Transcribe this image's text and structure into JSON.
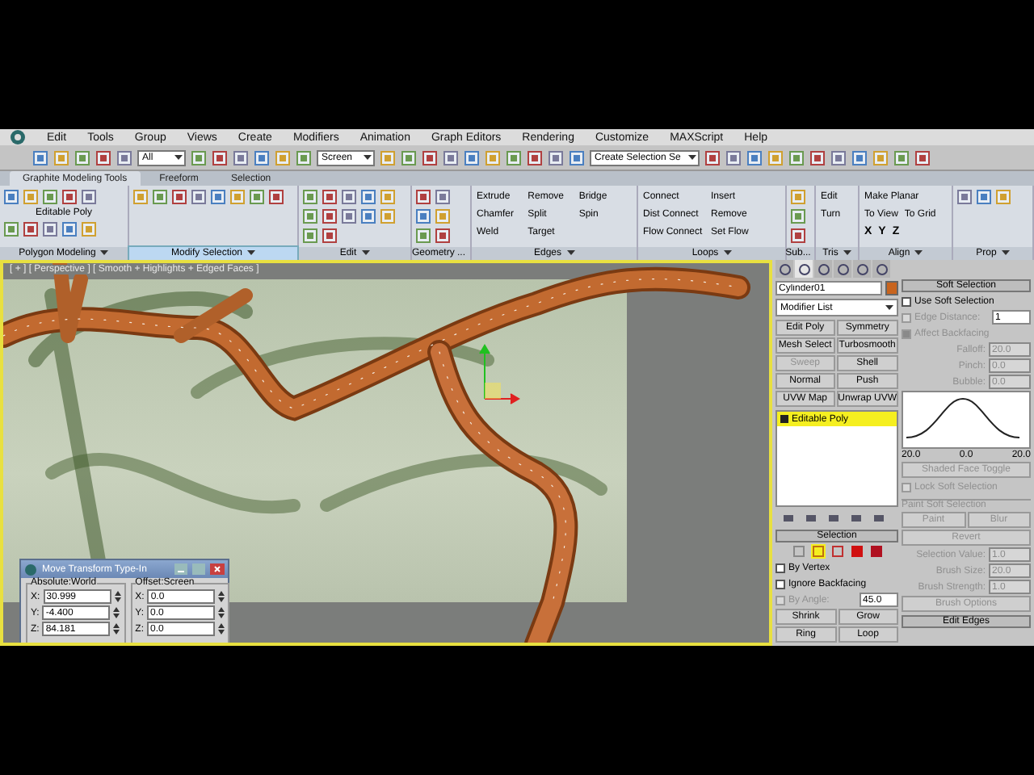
{
  "menu_bar": [
    "Edit",
    "Tools",
    "Group",
    "Views",
    "Create",
    "Modifiers",
    "Animation",
    "Graph Editors",
    "Rendering",
    "Customize",
    "MAXScript",
    "Help"
  ],
  "toolbar": {
    "selection_filter": "All",
    "reference_coord": "Screen",
    "named_selection": "Create Selection Se"
  },
  "ribbon_tabs": [
    {
      "label": "Graphite Modeling Tools",
      "selected": true
    },
    {
      "label": "Freeform",
      "selected": false
    },
    {
      "label": "Selection",
      "selected": false
    }
  ],
  "ribbon_panels": [
    {
      "title": "Polygon Modeling",
      "hovered": false,
      "items": [
        "Editable Poly"
      ]
    },
    {
      "title": "Modify Selection",
      "hovered": true
    },
    {
      "title": "Edit",
      "hovered": false
    },
    {
      "title": "Geometry ...",
      "hovered": false
    },
    {
      "title": "Edges",
      "hovered": false,
      "items": [
        "Extrude",
        "Remove",
        "Bridge",
        "Chamfer",
        "Split",
        "Spin",
        "Weld",
        "Target"
      ]
    },
    {
      "title": "Loops",
      "hovered": false,
      "items": [
        "Connect",
        "Insert",
        "Dist Connect",
        "Remove",
        "Flow Connect",
        "Set Flow"
      ]
    },
    {
      "title": "Sub...",
      "hovered": false
    },
    {
      "title": "Tris",
      "hovered": false,
      "items": [
        "Edit",
        "Turn"
      ]
    },
    {
      "title": "Align",
      "hovered": false,
      "items": [
        "Make Planar",
        "To View",
        "To Grid",
        "X",
        "Y",
        "Z"
      ]
    },
    {
      "title": "Prop",
      "hovered": false
    }
  ],
  "viewport": {
    "label": "[ + ] [ Perspective ] [ Smooth + Highlights + Edged Faces ]",
    "active": true
  },
  "typein_dialog": {
    "title": "Move Transform Type-In",
    "groups": [
      {
        "title": "Absolute:World",
        "fields": [
          {
            "label": "X:",
            "value": "30.999"
          },
          {
            "label": "Y:",
            "value": "-4.400"
          },
          {
            "label": "Z:",
            "value": "84.181"
          }
        ]
      },
      {
        "title": "Offset:Screen",
        "fields": [
          {
            "label": "X:",
            "value": "0.0"
          },
          {
            "label": "Y:",
            "value": "0.0"
          },
          {
            "label": "Z:",
            "value": "0.0"
          }
        ]
      }
    ]
  },
  "command_panel": {
    "tabs": [
      {
        "selected": false
      },
      {
        "selected": true
      },
      {
        "selected": false
      },
      {
        "selected": false
      },
      {
        "selected": false
      },
      {
        "selected": false
      }
    ],
    "object_name": "Cylinder01",
    "modifier_list": "Modifier List",
    "modifier_buttons": [
      {
        "label": "Edit Poly",
        "disabled": false
      },
      {
        "label": "Symmetry",
        "disabled": false
      },
      {
        "label": "Mesh Select",
        "disabled": false
      },
      {
        "label": "Turbosmooth",
        "disabled": false
      },
      {
        "label": "Sweep",
        "disabled": true
      },
      {
        "label": "Shell",
        "disabled": false
      },
      {
        "label": "Normal",
        "disabled": false
      },
      {
        "label": "Push",
        "disabled": false
      },
      {
        "label": "UVW Map",
        "disabled": false
      },
      {
        "label": "Unwrap UVW",
        "disabled": false
      }
    ],
    "stack": [
      {
        "label": "Editable Poly",
        "selected": true
      }
    ],
    "selection": {
      "title": "Selection",
      "levels": [
        {
          "selected": false
        },
        {
          "selected": true
        },
        {
          "selected": false
        },
        {
          "selected": false
        },
        {
          "selected": false
        }
      ],
      "checks": [
        {
          "label": "By Vertex",
          "checked": false,
          "disabled": false
        },
        {
          "label": "Ignore Backfacing",
          "checked": false,
          "disabled": false
        },
        {
          "label": "By Angle:",
          "checked": false,
          "disabled": true,
          "value": "45.0"
        }
      ],
      "buttons": [
        "Shrink",
        "Grow",
        "Ring",
        "Loop"
      ]
    },
    "soft_selection": {
      "title": "Soft Selection",
      "rows": [
        {
          "kind": "check",
          "label": "Use Soft Selection",
          "checked": false,
          "disabled": false
        },
        {
          "kind": "check",
          "label": "Edge Distance:",
          "checked": false,
          "disabled": true,
          "value": "1"
        },
        {
          "kind": "check",
          "label": "Affect Backfacing",
          "checked": true,
          "disabled": true
        },
        {
          "kind": "spin",
          "label": "Falloff:",
          "value": "20.0",
          "disabled": true
        },
        {
          "kind": "spin",
          "label": "Pinch:",
          "value": "0.0",
          "disabled": true
        },
        {
          "kind": "spin",
          "label": "Bubble:",
          "value": "0.0",
          "disabled": true
        },
        {
          "kind": "curve",
          "ticks": [
            "20.0",
            "0.0",
            "20.0"
          ]
        },
        {
          "kind": "button",
          "label": "Shaded Face Toggle",
          "disabled": true
        },
        {
          "kind": "check",
          "label": "Lock Soft Selection",
          "checked": false,
          "disabled": true
        },
        {
          "kind": "group",
          "label": "Paint Soft Selection"
        },
        {
          "kind": "buttons",
          "labels": [
            "Paint",
            "Blur"
          ],
          "disabled": true
        },
        {
          "kind": "button",
          "label": "Revert",
          "disabled": true
        },
        {
          "kind": "spin",
          "label": "Selection Value:",
          "value": "1.0",
          "disabled": true
        },
        {
          "kind": "spin",
          "label": "Brush Size:",
          "value": "20.0",
          "disabled": true
        },
        {
          "kind": "spin",
          "label": "Brush Strength:",
          "value": "1.0",
          "disabled": true
        },
        {
          "kind": "button",
          "label": "Brush Options",
          "disabled": true
        }
      ]
    },
    "edit_edges": {
      "title": "Edit Edges"
    }
  }
}
